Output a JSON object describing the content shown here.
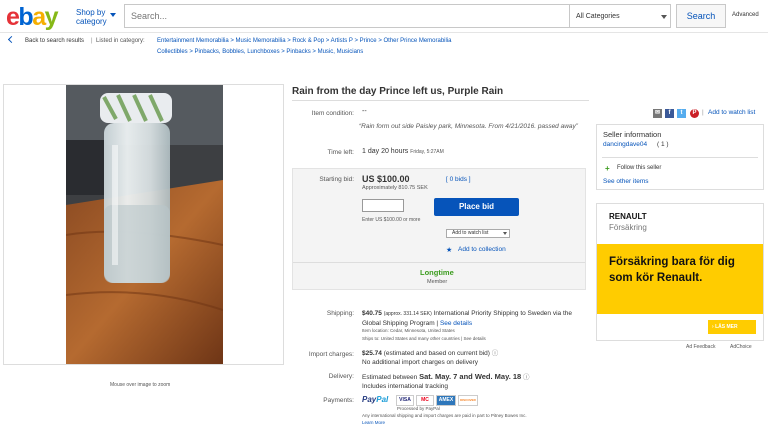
{
  "header": {
    "logo": [
      "e",
      "b",
      "a",
      "y"
    ],
    "logo_colors": [
      "#e53238",
      "#0064d2",
      "#f5af02",
      "#86b817"
    ],
    "shop_by": "Shop by",
    "category": "category",
    "search_placeholder": "Search...",
    "category_select": "All Categories",
    "search_button": "Search",
    "advanced": "Advanced"
  },
  "breadcrumb": {
    "back": "Back to search results",
    "separator": "|",
    "listed_in": "Listed in category:",
    "line1": "Entertainment Memorabilia  >  Music Memorabilia  >  Rock & Pop  >  Artists P  >  Prince  >  Other Prince Memorabilia",
    "line2": "Collectibles  >  Pinbacks, Bobbles, Lunchboxes  >  Pinbacks  >  Music, Musicians"
  },
  "gallery": {
    "zoom_hint": "Mouse over image to zoom"
  },
  "item": {
    "title": "Rain from the day Prince left us, Purple Rain",
    "condition_label": "Item condition:",
    "condition_value": "--",
    "condition_desc": "“Rain form out side Paisley park, Minnesota. From 4/21/2016. passed away”",
    "time_label": "Time left:",
    "time_value": "1 day 20 hours",
    "time_detail": "Friday, 5:27AM"
  },
  "bid": {
    "starting_label": "Starting bid:",
    "price": "US $100.00",
    "approx": "Approximately 810.75 SEK",
    "bids_link": "[ 0 bids ]",
    "hint": "Enter US $100.00 or more",
    "place_bid": "Place bid",
    "watch_select": "Add to watch list",
    "add_collection": "Add to collection",
    "badge": "Longtime",
    "member": "Member"
  },
  "shipping": {
    "label": "Shipping:",
    "price": "$40.75",
    "approx": "(approx. 331.14 SEK)",
    "desc": "International Priority Shipping to Sweden via the Global Shipping Program",
    "see_details": "See details",
    "location": "Item location:  Cedar, Minnesota, United States",
    "ships_to": "Ships to:  United States and many other countries  |  See details"
  },
  "import": {
    "label": "Import charges:",
    "value": "$25.74",
    "desc": "(estimated and based on current bid)",
    "note": "No additional import charges on delivery"
  },
  "delivery": {
    "label": "Delivery:",
    "prefix": "Estimated between",
    "dates": "Sat. May. 7 and Wed. May. 18",
    "note": "Includes international tracking"
  },
  "payments": {
    "label": "Payments:",
    "paypal_a": "Pay",
    "paypal_b": "Pal",
    "cards": [
      "VISA",
      "MC",
      "AMEX",
      "DISCOVER"
    ],
    "processed": "Processed by PayPal",
    "note": "Any international shipping and import charges are paid in part to Pitney Bowes Inc.",
    "learn_more": "Learn More"
  },
  "social": {
    "add_watch": "Add to watch list",
    "icons": [
      "email-icon",
      "facebook-icon",
      "twitter-icon",
      "pinterest-icon"
    ],
    "icon_glyphs": [
      "✉",
      "f",
      "t",
      "P"
    ],
    "icon_colors": [
      "#777777",
      "#3b5998",
      "#55acee",
      "#cb2027"
    ]
  },
  "seller": {
    "heading": "Seller information",
    "name": "dancingdave04",
    "score": "( 1 )",
    "follow": "Follow this seller",
    "other_items": "See other items"
  },
  "ad": {
    "brand": "RENAULT",
    "sub": "Försäkring",
    "copy": "Försäkring bara för dig som kör Renault.",
    "cta": "LÄS MER",
    "feedback": "Ad Feedback",
    "choice": "AdChoice"
  }
}
